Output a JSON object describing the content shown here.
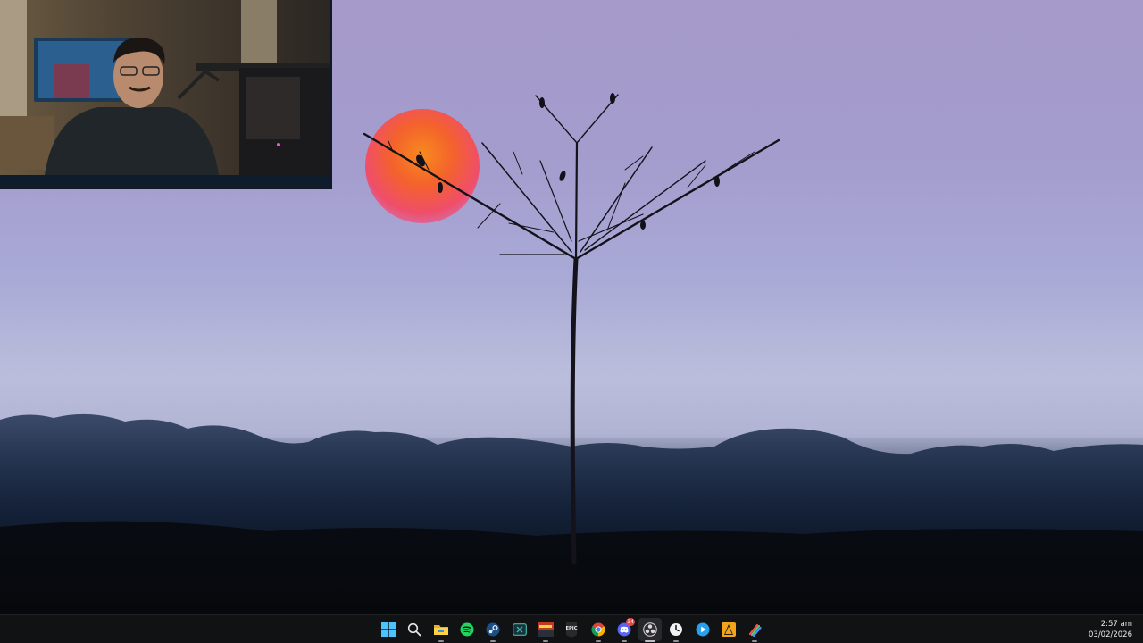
{
  "taskbar": {
    "items": [
      {
        "name": "start",
        "icon": "windows-logo-icon"
      },
      {
        "name": "search",
        "icon": "search-icon"
      },
      {
        "name": "file-explorer",
        "icon": "folder-icon"
      },
      {
        "name": "spotify",
        "icon": "spotify-icon"
      },
      {
        "name": "steam",
        "icon": "steam-icon"
      },
      {
        "name": "xbox",
        "icon": "xbox-icon"
      },
      {
        "name": "game-app",
        "icon": "game-cover-icon"
      },
      {
        "name": "epic-games",
        "icon": "epic-games-icon",
        "label": "EPIC"
      },
      {
        "name": "chrome",
        "icon": "chrome-icon"
      },
      {
        "name": "discord",
        "icon": "discord-icon",
        "badge": "34"
      },
      {
        "name": "obs",
        "icon": "obs-icon"
      },
      {
        "name": "clock-app",
        "icon": "clock-icon"
      },
      {
        "name": "media-app",
        "icon": "play-icon"
      },
      {
        "name": "vlc-like-app",
        "icon": "cone-icon"
      },
      {
        "name": "paint-app",
        "icon": "brush-icon"
      }
    ],
    "clock": {
      "time": "2:57 am",
      "date": "03/02/2026"
    }
  },
  "colors": {
    "sky": "#a59ac9",
    "sun": "#f26a3a",
    "taskbar": "#111214",
    "accent": "#4cc2ff"
  }
}
